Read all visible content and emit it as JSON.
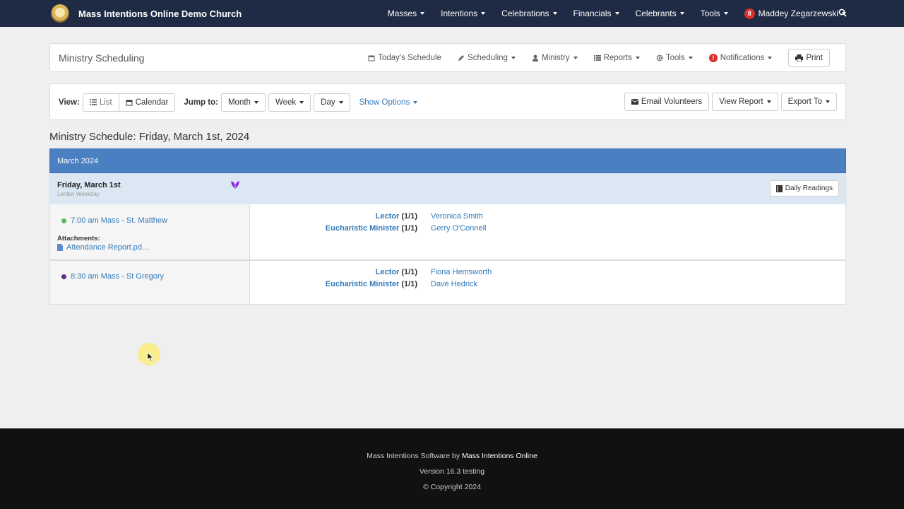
{
  "navbar": {
    "brand": "Mass Intentions Online Demo Church",
    "items": [
      "Masses",
      "Intentions",
      "Celebrations",
      "Financials",
      "Celebrants",
      "Tools"
    ],
    "user": {
      "badge": "8",
      "name": "Maddey Zegarzewski"
    }
  },
  "header": {
    "title": "Ministry Scheduling",
    "menu": [
      "Today's Schedule",
      "Scheduling",
      "Ministry",
      "Reports",
      "Tools",
      "Notifications"
    ],
    "print": "Print"
  },
  "toolbar": {
    "view_label": "View:",
    "list": "List",
    "calendar": "Calendar",
    "jump_label": "Jump to:",
    "month": "Month",
    "week": "Week",
    "day": "Day",
    "show_options": "Show Options",
    "email": "Email Volunteers",
    "view_report": "View Report",
    "export": "Export To"
  },
  "schedule": {
    "title": "Ministry Schedule: Friday, March 1st, 2024",
    "month": "March 2024",
    "day_name": "Friday, March 1st",
    "day_sub": "Lenten Weekday",
    "daily_readings": "Daily Readings",
    "masses": [
      {
        "time": "7:00 am Mass - St. Matthew",
        "dot_color": "#5cb85c",
        "attachments_label": "Attachments:",
        "attachment": "Attendance Report.pd...",
        "roles": [
          {
            "name": "Lector",
            "count": "(1/1)",
            "volunteer": "Veronica Smith"
          },
          {
            "name": "Eucharistic Minister",
            "count": "(1/1)",
            "volunteer": "Gerry O'Connell"
          }
        ]
      },
      {
        "time": "8:30 am Mass - St Gregory",
        "dot_color": "#5b2d8a",
        "roles": [
          {
            "name": "Lector",
            "count": "(1/1)",
            "volunteer": "Fiona Hemsworth"
          },
          {
            "name": "Eucharistic Minister",
            "count": "(1/1)",
            "volunteer": "Dave Hedrick"
          }
        ]
      }
    ]
  },
  "footer": {
    "line1_prefix": "Mass Intentions Software by",
    "line1_brand": "Mass Intentions Online",
    "version": "Version 16.3 testing",
    "copyright": "© Copyright 2024"
  },
  "colors": {
    "navbar": "#1f2a44",
    "month_bar": "#4a7fc1",
    "day_row": "#dbe8f4",
    "link": "#337ab7"
  }
}
